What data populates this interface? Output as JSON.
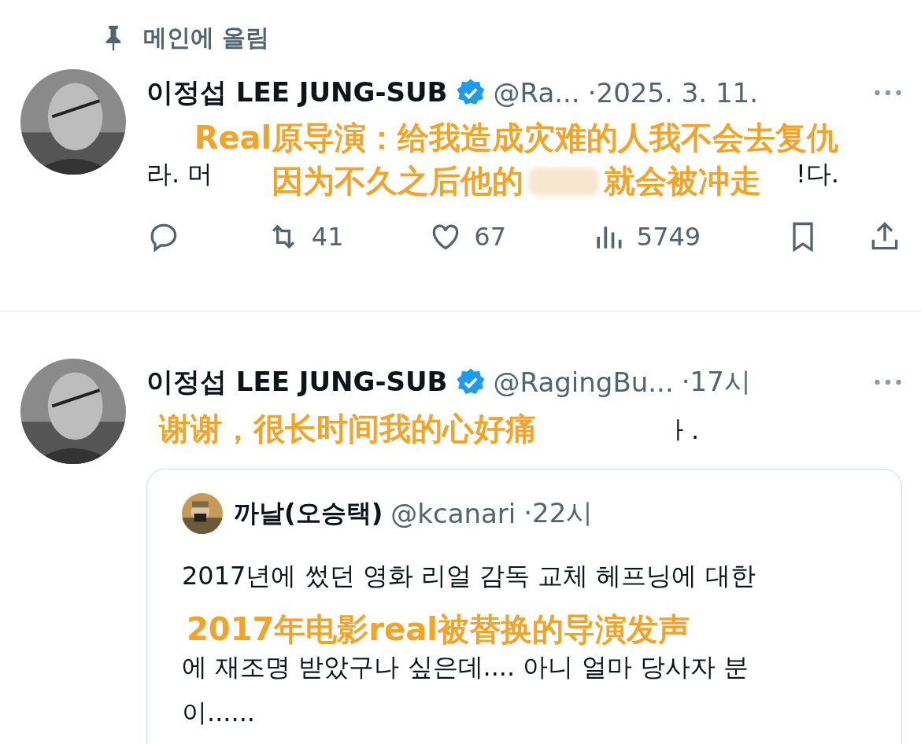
{
  "pinned": {
    "label": "메인에 올림"
  },
  "tweets": [
    {
      "author": "이정섭 LEE JUNG-SUB",
      "verified": true,
      "handle": "@Ra...",
      "time": "·2025. 3. 11.",
      "text_left": "라. 머",
      "text_right": "!다.",
      "captions": [
        [
          "Real原导演：给我造成灾难的人我不会去复仇"
        ],
        [
          "因为不久之后他的",
          "就会被冲走"
        ]
      ],
      "actions": {
        "retweets": "41",
        "likes": "67",
        "views": "5749"
      }
    },
    {
      "author": "이정섭 LEE JUNG-SUB",
      "verified": true,
      "handle": "@RagingBu...",
      "time": "·17시",
      "text_right": "ㅏ.",
      "captions": [
        [
          "谢谢，很长时间我的心好痛"
        ]
      ],
      "quote": {
        "author": "까날(오승택)",
        "handle": "@kcanari",
        "time": "·22시",
        "lines": [
          "2017년에 썼던 영화 리얼 감독 교체 헤프닝에 대한",
          "에 재조명 받았구나 싶은데.... 아니 얼마 당사자 분",
          "이......"
        ],
        "caption": "2017年电影real被替换的导演发声"
      }
    }
  ]
}
